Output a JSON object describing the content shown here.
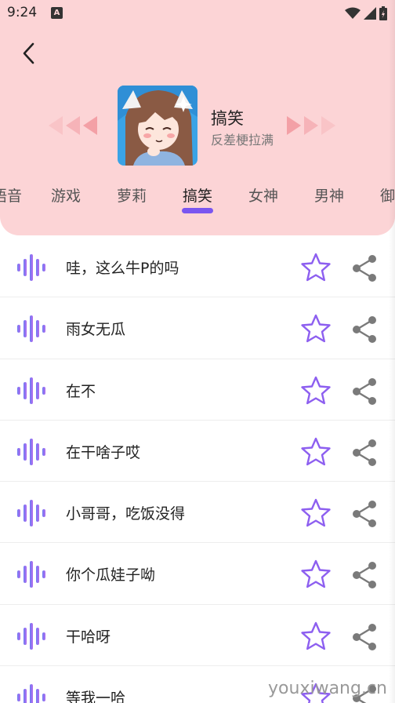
{
  "status_bar": {
    "time": "9:24",
    "notif_letter": "A"
  },
  "category": {
    "title": "搞笑",
    "subtitle": "反差梗拉满"
  },
  "tabs": [
    {
      "label": "语音",
      "active": false
    },
    {
      "label": "游戏",
      "active": false
    },
    {
      "label": "萝莉",
      "active": false
    },
    {
      "label": "搞笑",
      "active": true
    },
    {
      "label": "女神",
      "active": false
    },
    {
      "label": "男神",
      "active": false
    },
    {
      "label": "御",
      "active": false
    }
  ],
  "items": [
    {
      "text": "哇，这么牛P的吗"
    },
    {
      "text": "雨女无瓜"
    },
    {
      "text": "在不"
    },
    {
      "text": "在干啥子哎"
    },
    {
      "text": "小哥哥，吃饭没得"
    },
    {
      "text": "你个瓜娃子呦"
    },
    {
      "text": "干哈呀"
    },
    {
      "text": "等我一哈"
    }
  ],
  "icons": {
    "wave": "audio-wave-icon",
    "star": "star-outline-icon",
    "share": "share-icon",
    "back": "chevron-left-icon"
  },
  "colors": {
    "header_bg": "#fcd4d6",
    "accent_purple": "#7a56f0",
    "arrow_pink": "#f5a6ab"
  },
  "watermark": "youxiwang.cn"
}
